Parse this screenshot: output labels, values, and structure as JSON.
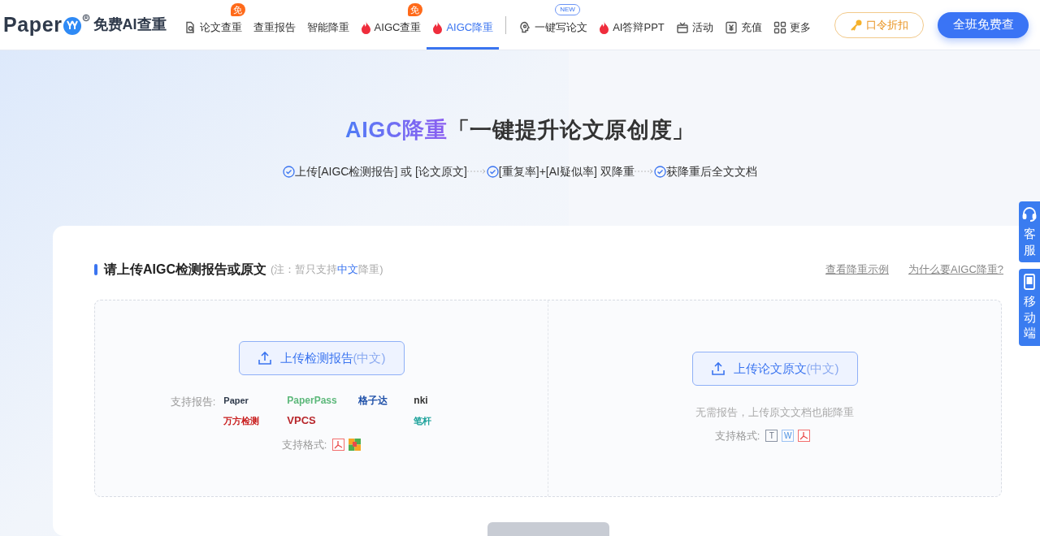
{
  "nav": {
    "logo": "Paper",
    "logo_tagline": "免费AI查重",
    "items": [
      {
        "label": "论文查重",
        "kind": "search-doc",
        "badge": "免",
        "selected": false
      },
      {
        "label": "查重报告",
        "selected": false
      },
      {
        "label": "智能降重",
        "selected": false
      },
      {
        "label": "AIGC查重",
        "kind": "fire",
        "badge": "免",
        "selected": false
      },
      {
        "label": "AIGC降重",
        "kind": "fire",
        "selected": true
      },
      {
        "kind": "divider"
      },
      {
        "label": "一键写论文",
        "kind": "bulb",
        "badge": "NEW",
        "selected": false
      },
      {
        "label": "AI答辩PPT",
        "kind": "fire",
        "selected": false
      },
      {
        "label": "活动",
        "kind": "gift",
        "selected": false
      },
      {
        "label": "充值",
        "kind": "yen",
        "selected": false
      },
      {
        "label": "更多",
        "kind": "grid",
        "selected": false
      }
    ],
    "coupon_button": "口令折扣",
    "main_button": "全班免费查"
  },
  "hero": {
    "title_highlight": "AIGC降重",
    "title_rest": "「一键提升论文原创度」",
    "steps": [
      "上传[AIGC检测报告] 或 [论文原文]",
      "[重复率]+[AI疑似率] 双降重",
      "获降重后全文文档"
    ]
  },
  "side_widgets": [
    {
      "label": "客服",
      "kind": "headset"
    },
    {
      "label": "移动端",
      "kind": "phone"
    }
  ],
  "upload": {
    "heading": "请上传AIGC检测报告或原文",
    "note": "(注：暂只支持**中文**降重)",
    "links": [
      "查看降重示例",
      "为什么要AIGC降重?"
    ],
    "report": {
      "button": "上传检测报告",
      "button_suffix": "(中文)",
      "supported_label": "支持报告:",
      "logos": [
        {
          "label": "Paper",
          "kind": "paperyy"
        },
        {
          "label": "PaperPass",
          "kind": "paperpass"
        },
        {
          "label": "格子达",
          "kind": "gezida"
        },
        {
          "label": "nki",
          "kind": "cnki"
        },
        {
          "label": "万方检测",
          "kind": "wanfang"
        },
        {
          "label": "VPCS",
          "kind": "vpcs"
        },
        {
          "label": "笔杆",
          "kind": "bigan"
        }
      ],
      "formats_label": "支持格式:",
      "formats": [
        {
          "kind": "pdf"
        },
        {
          "kind": "zip"
        }
      ]
    },
    "original": {
      "button": "上传论文原文",
      "button_suffix": "(中文)",
      "hint": "无需报告，上传原文文档也能降重",
      "formats_label": "支持格式:",
      "formats": [
        {
          "kind": "txt",
          "label": "T"
        },
        {
          "kind": "word",
          "label": "W"
        },
        {
          "kind": "pdf"
        }
      ]
    }
  },
  "submit": {
    "disabled": true
  }
}
